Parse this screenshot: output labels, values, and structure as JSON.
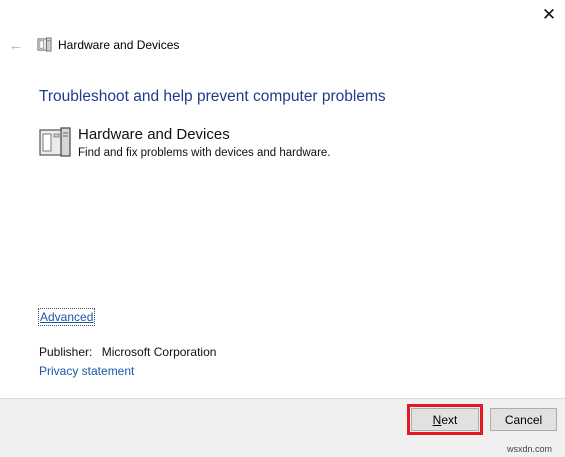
{
  "window": {
    "title": "Hardware and Devices",
    "close_glyph": "✕",
    "back_glyph": "←"
  },
  "heading": "Troubleshoot and help prevent computer problems",
  "troubleshooter": {
    "title": "Hardware and Devices",
    "description": "Find and fix problems with devices and hardware.",
    "icon": "hardware-devices-icon"
  },
  "links": {
    "advanced": "Advanced",
    "privacy": "Privacy statement"
  },
  "publisher": {
    "label": "Publisher:",
    "value": "Microsoft Corporation"
  },
  "buttons": {
    "next_first": "N",
    "next_rest": "ext",
    "cancel": "Cancel"
  },
  "watermark": "wsxdn.com",
  "colors": {
    "heading": "#1e3b8e",
    "link": "#1a57a6",
    "highlight": "#e21a24",
    "footer_bg": "#f0f0f0"
  }
}
